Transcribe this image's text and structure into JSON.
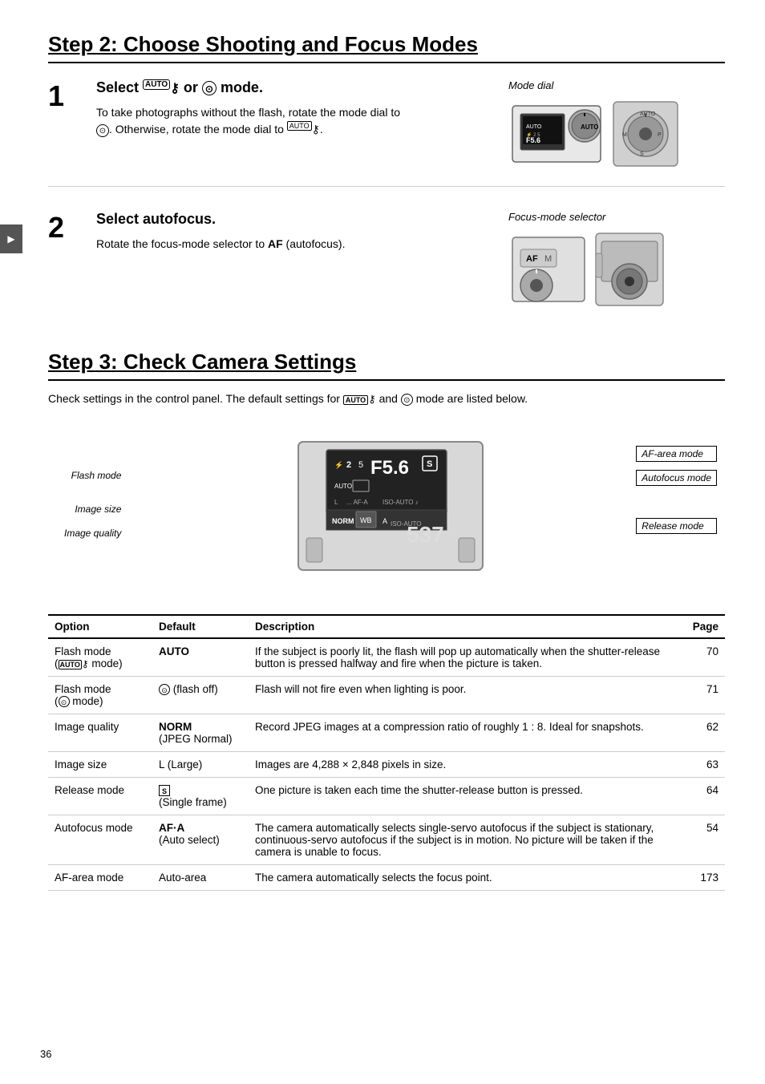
{
  "page": {
    "number": "36"
  },
  "step2": {
    "heading": "Step 2: Choose Shooting and Focus Modes",
    "steps": [
      {
        "number": "1",
        "title": "Select AUTO or ⊙ mode.",
        "body": "To take photographs without the flash, rotate the mode dial to ⊙.  Otherwise, rotate the mode dial to AUTO.",
        "image_label": "Mode dial"
      },
      {
        "number": "2",
        "title": "Select autofocus.",
        "body": "Rotate the focus-mode selector to AF (autofocus).",
        "image_label": "Focus-mode selector"
      }
    ]
  },
  "step3": {
    "heading": "Step 3: Check Camera Settings",
    "description": "Check settings in the control panel.  The default settings for AUTO and ⊙ mode are listed below.",
    "callouts": {
      "af_area_mode": "AF-area mode",
      "autofocus_mode": "Autofocus mode",
      "flash_mode": "Flash mode",
      "image_size": "Image size",
      "image_quality": "Image quality",
      "release_mode": "Release mode"
    },
    "table": {
      "headers": [
        "Option",
        "Default",
        "Description",
        "Page"
      ],
      "rows": [
        {
          "option": "Flash mode (AUTO mode)",
          "default": "AUTO",
          "description": "If the subject is poorly lit, the flash will pop up automatically when the shutter-release button is pressed halfway and fire when the picture is taken.",
          "page": "70"
        },
        {
          "option": "Flash mode (⊙ mode)",
          "default": "⊙ (flash off)",
          "description": "Flash will not fire even when lighting is poor.",
          "page": "71"
        },
        {
          "option": "Image quality",
          "default": "NORM (JPEG Normal)",
          "description": "Record JPEG images at a compression ratio of roughly 1 : 8.  Ideal for snapshots.",
          "page": "62"
        },
        {
          "option": "Image size",
          "default": "L (Large)",
          "description": "Images are 4,288 × 2,848 pixels in size.",
          "page": "63"
        },
        {
          "option": "Release mode",
          "default": "S (Single frame)",
          "description": "One picture is taken each time the shutter-release button is pressed.",
          "page": "64"
        },
        {
          "option": "Autofocus mode",
          "default": "AF·A (Auto select)",
          "description": "The camera automatically selects single-servo autofocus if the subject is stationary, continuous-servo autofocus if the subject is in motion.  No picture will be taken if the camera is unable to focus.",
          "page": "54"
        },
        {
          "option": "AF-area mode",
          "default": "Auto-area",
          "description": "The camera automatically selects the focus point.",
          "page": "173"
        }
      ]
    }
  }
}
